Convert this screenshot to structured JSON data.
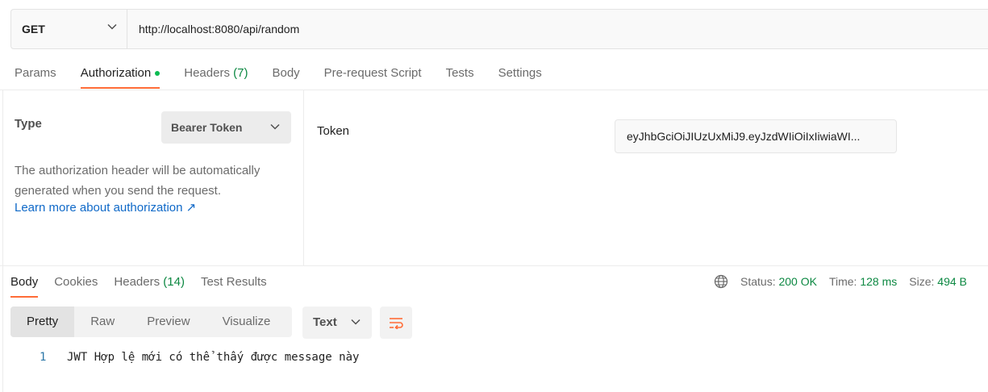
{
  "request": {
    "method": "GET",
    "url": "http://localhost:8080/api/random"
  },
  "request_tabs": [
    {
      "label": "Params"
    },
    {
      "label": "Authorization",
      "active": true,
      "indicator": "green-dot"
    },
    {
      "label": "Headers",
      "count": "(7)"
    },
    {
      "label": "Body"
    },
    {
      "label": "Pre-request Script"
    },
    {
      "label": "Tests"
    },
    {
      "label": "Settings"
    }
  ],
  "auth": {
    "type_label": "Type",
    "type_value": "Bearer Token",
    "description": "The authorization header will be automatically generated when you send the request.",
    "learn_more": "Learn more about authorization ↗",
    "token_label": "Token",
    "token_value": "eyJhbGciOiJIUzUxMiJ9.eyJzdWIiOiIxIiwiaWI..."
  },
  "response_tabs": [
    {
      "label": "Body",
      "active": true
    },
    {
      "label": "Cookies"
    },
    {
      "label": "Headers",
      "count": "(14)"
    },
    {
      "label": "Test Results"
    }
  ],
  "response_status": {
    "icon": "globe-icon",
    "status_label": "Status:",
    "status_value": "200 OK",
    "time_label": "Time:",
    "time_value": "128 ms",
    "size_label": "Size:",
    "size_value": "494 B"
  },
  "view_modes": [
    {
      "label": "Pretty",
      "active": true
    },
    {
      "label": "Raw"
    },
    {
      "label": "Preview"
    },
    {
      "label": "Visualize"
    }
  ],
  "format": "Text",
  "body_lines": [
    {
      "number": "1",
      "text": "JWT Hợp lệ mới có thể thấy được message này"
    }
  ],
  "colors": {
    "accent": "#ff6c37",
    "success": "#0c8842",
    "link": "#0f69c8"
  }
}
